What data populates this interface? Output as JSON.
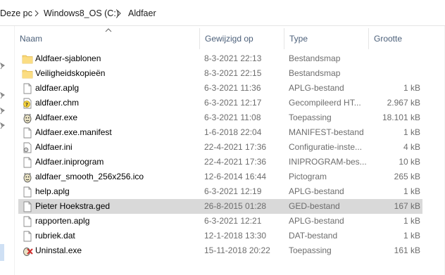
{
  "breadcrumb": [
    "Deze pc",
    "Windows8_OS (C:)",
    "Aldfaer"
  ],
  "columns": {
    "name": "Naam",
    "date": "Gewijzigd op",
    "type": "Type",
    "size": "Grootte"
  },
  "files": [
    {
      "name": "Aldfaer-sjablonen",
      "date": "8-3-2021 22:13",
      "type": "Bestandsmap",
      "size": "",
      "icon": "folder-icon"
    },
    {
      "name": "Veiligheidskopieën",
      "date": "8-3-2021 22:15",
      "type": "Bestandsmap",
      "size": "",
      "icon": "folder-icon"
    },
    {
      "name": "aldfaer.aplg",
      "date": "6-3-2021 11:36",
      "type": "APLG-bestand",
      "size": "1 kB",
      "icon": "file-icon"
    },
    {
      "name": "aldfaer.chm",
      "date": "6-3-2021 12:17",
      "type": "Gecompileerd HT...",
      "size": "2.967 kB",
      "icon": "help-file-icon"
    },
    {
      "name": "Aldfaer.exe",
      "date": "6-3-2021 11:08",
      "type": "Toepassing",
      "size": "18.101 kB",
      "icon": "app-icon"
    },
    {
      "name": "Aldfaer.exe.manifest",
      "date": "1-6-2018 22:04",
      "type": "MANIFEST-bestand",
      "size": "1 kB",
      "icon": "file-icon"
    },
    {
      "name": "Aldfaer.ini",
      "date": "22-4-2021 17:36",
      "type": "Configuratie-inste...",
      "size": "4 kB",
      "icon": "settings-file-icon"
    },
    {
      "name": "Aldfaer.iniprogram",
      "date": "22-4-2021 17:36",
      "type": "INIPROGRAM-bes...",
      "size": "10 kB",
      "icon": "file-icon"
    },
    {
      "name": "aldfaer_smooth_256x256.ico",
      "date": "12-6-2014 16:44",
      "type": "Pictogram",
      "size": "265 kB",
      "icon": "app-icon"
    },
    {
      "name": "help.aplg",
      "date": "6-3-2021 12:19",
      "type": "APLG-bestand",
      "size": "1 kB",
      "icon": "file-icon"
    },
    {
      "name": "Pieter Hoekstra.ged",
      "date": "26-8-2015 01:28",
      "type": "GED-bestand",
      "size": "167 kB",
      "icon": "file-icon",
      "selected": true
    },
    {
      "name": "rapporten.aplg",
      "date": "6-3-2021 12:21",
      "type": "APLG-bestand",
      "size": "1 kB",
      "icon": "file-icon"
    },
    {
      "name": "rubriek.dat",
      "date": "12-1-2018 13:30",
      "type": "DAT-bestand",
      "size": "1 kB",
      "icon": "file-icon"
    },
    {
      "name": "Uninstal.exe",
      "date": "15-11-2018 20:22",
      "type": "Toepassing",
      "size": "161 kB",
      "icon": "uninstall-app-icon"
    }
  ],
  "colors": {
    "folder": "#f8d775",
    "selected_row": "#d9d9d9",
    "header_text": "#4c607a"
  }
}
